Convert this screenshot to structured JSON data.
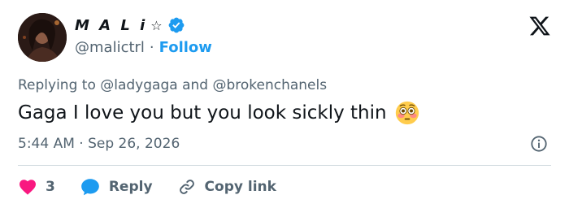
{
  "author": {
    "display_name": "M A L i",
    "name_symbol": "☆",
    "handle": "@malictrl",
    "separator": "·",
    "follow_label": "Follow"
  },
  "reply_context": {
    "prefix": "Replying to",
    "mention_1": "@ladygaga",
    "conjunction": "and",
    "mention_2": "@brokenchanels"
  },
  "tweet": {
    "text": "Gaga I love you but you look sickly thin",
    "emoji": "flushed-face"
  },
  "meta": {
    "time": "5:44 AM",
    "separator": "·",
    "date": "Sep 26, 2026"
  },
  "actions": {
    "like_count": "3",
    "reply_label": "Reply",
    "copy_link_label": "Copy link"
  },
  "colors": {
    "accent": "#1d9bf0",
    "like": "#f91880",
    "secondary_text": "#536471",
    "divider": "#cfd9de"
  }
}
